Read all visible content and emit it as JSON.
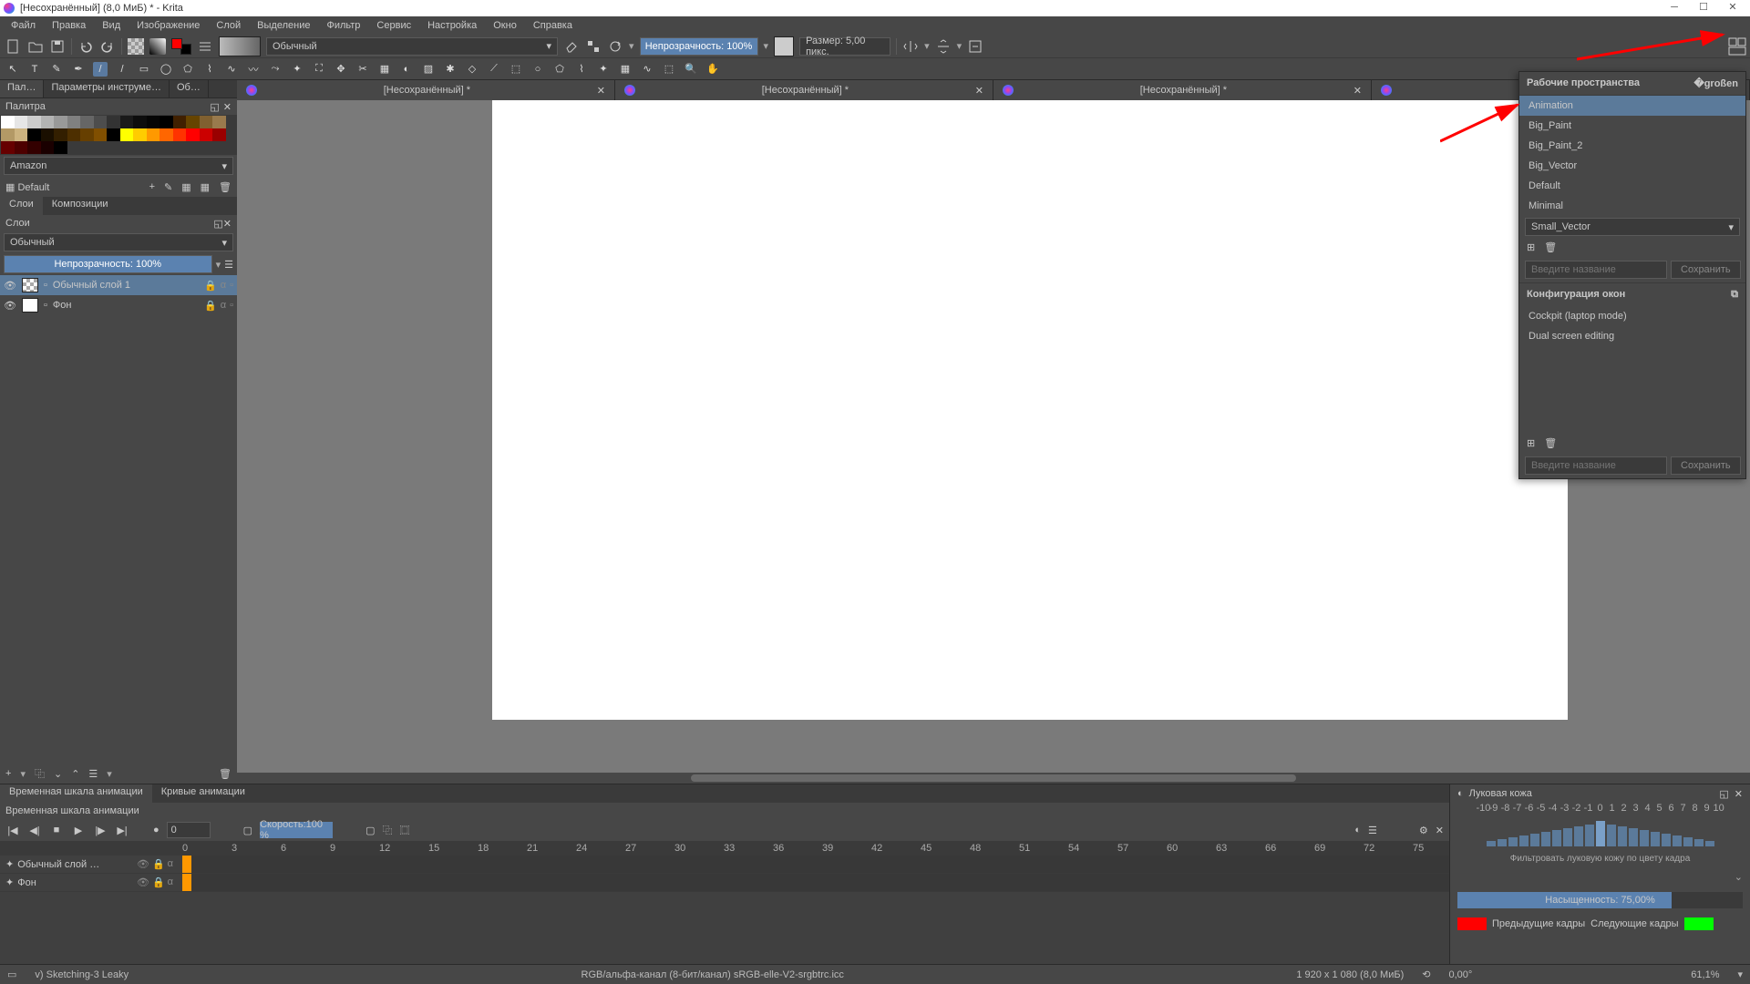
{
  "title": "[Несохранённый]  (8,0 МиБ)  * - Krita",
  "menu": [
    "Файл",
    "Правка",
    "Вид",
    "Изображение",
    "Слой",
    "Выделение",
    "Фильтр",
    "Сервис",
    "Настройка",
    "Окно",
    "Справка"
  ],
  "toolbar": {
    "blend_mode": "Обычный",
    "opacity": "Непрозрачность: 100%",
    "size": "Размер: 5,00 пикс."
  },
  "left": {
    "tabs": [
      "Пал…",
      "Параметры инструме…",
      "Об…"
    ],
    "palette_header": "Палитра",
    "palette_name": "Amazon",
    "palette_default": "Default",
    "layer_tabs": [
      "Слои",
      "Композиции"
    ],
    "layer_header": "Слои",
    "layer_mode": "Обычный",
    "layer_opacity": "Непрозрачность:  100%",
    "layers": [
      {
        "name": "Обычный слой 1",
        "selected": true,
        "thumb": "checker"
      },
      {
        "name": "Фон",
        "selected": false,
        "thumb": "white"
      }
    ]
  },
  "docs": [
    {
      "name": "[Несохранённый] *"
    },
    {
      "name": "[Несохранённый] *"
    },
    {
      "name": "[Несохранённый] *"
    },
    {
      "name": ""
    }
  ],
  "workspace": {
    "title": "Рабочие пространства",
    "items": [
      "Animation",
      "Big_Paint",
      "Big_Paint_2",
      "Big_Vector",
      "Default",
      "Minimal",
      "Small_Vector"
    ],
    "selected": "Animation",
    "input_placeholder": "Введите название",
    "save": "Сохранить",
    "win_config": "Конфигурация окон",
    "configs": [
      "Cockpit (laptop mode)",
      "Dual screen editing"
    ]
  },
  "animation": {
    "tabs": [
      "Временная шкала анимации",
      "Кривые анимации"
    ],
    "header": "Временная шкала анимации",
    "frame": "0",
    "speed": "Скорость:100 %",
    "ruler": [
      0,
      3,
      6,
      9,
      12,
      15,
      18,
      21,
      24,
      27,
      30,
      33,
      36,
      39,
      42,
      45,
      48,
      51,
      54,
      57,
      60,
      63,
      66,
      69,
      72,
      75
    ],
    "tracks": [
      {
        "name": "Обычный слой …"
      },
      {
        "name": "Фон"
      }
    ],
    "onion_title": "Луковая кожа",
    "onion_nums": [
      -10,
      -9,
      -8,
      -7,
      -6,
      -5,
      -4,
      -3,
      -2,
      -1,
      0,
      1,
      2,
      3,
      4,
      5,
      6,
      7,
      8,
      9,
      10
    ],
    "onion_filter": "Фильтровать луковую кожу по цвету кадра",
    "saturation": "Насыщенность: 75,00%",
    "prev": "Предыдущие кадры",
    "next": "Следующие кадры"
  },
  "status": {
    "brush": "v) Sketching-3 Leaky",
    "color": "RGB/альфа-канал (8-бит/канал)  sRGB-elle-V2-srgbtrc.icc",
    "dims": "1 920 x 1 080 (8,0 МиБ)",
    "angle": "0,00°",
    "zoom": "61,1%"
  },
  "palette_colors_row1": [
    "#ffffff",
    "#e6e6e6",
    "#cccccc",
    "#b3b3b3",
    "#999999",
    "#808080",
    "#666666",
    "#4d4d4d",
    "#333333",
    "#1a1a1a",
    "#0d0d0d",
    "#050505",
    "#000000"
  ],
  "palette_colors_row2": [
    "#402000",
    "#664400",
    "#806030",
    "#997a4d",
    "#b39966",
    "#ccb380",
    "#000000",
    "#1a0f00",
    "#331f00",
    "#4d2f00",
    "#663f00",
    "#804f00",
    "#000000"
  ],
  "palette_colors_row3": [
    "#ffff00",
    "#ffcc00",
    "#ff9900",
    "#ff6600",
    "#ff3300",
    "#ff0000",
    "#cc0000",
    "#990000",
    "#660000",
    "#4d0000",
    "#330000",
    "#1a0000",
    "#000000"
  ]
}
